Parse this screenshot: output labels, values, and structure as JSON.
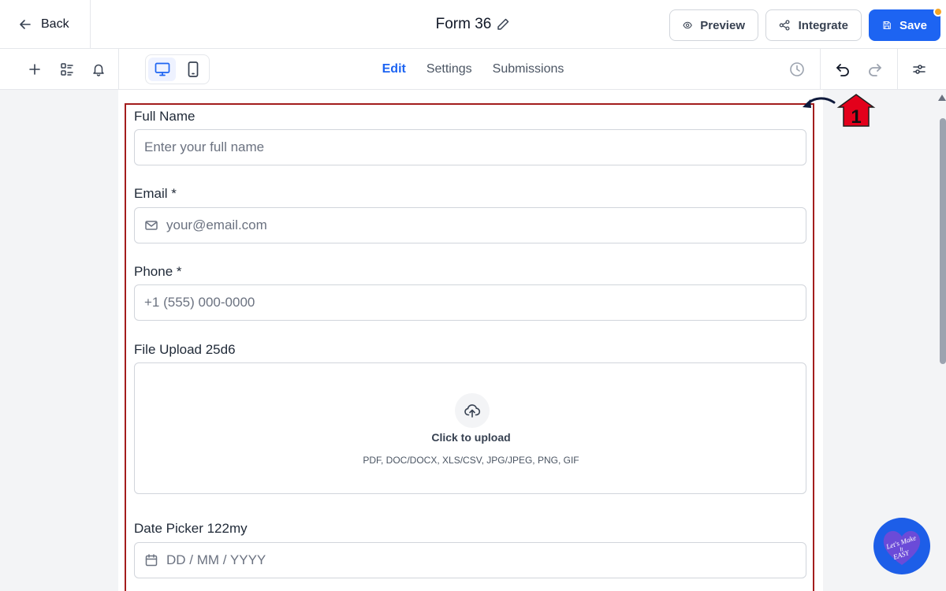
{
  "header": {
    "back_label": "Back",
    "form_title": "Form 36",
    "preview_label": "Preview",
    "integrate_label": "Integrate",
    "save_label": "Save"
  },
  "toolbar": {
    "tabs": [
      {
        "label": "Edit",
        "active": true
      },
      {
        "label": "Settings",
        "active": false
      },
      {
        "label": "Submissions",
        "active": false
      }
    ],
    "device_active": "desktop"
  },
  "form": {
    "fields": [
      {
        "label": "Full Name",
        "placeholder": "Enter your full name",
        "icon": ""
      },
      {
        "label": "Email *",
        "placeholder": "your@email.com",
        "icon": "mail-icon"
      },
      {
        "label": "Phone *",
        "placeholder": "+1 (555) 000-0000",
        "icon": ""
      },
      {
        "label": "File Upload 25d6",
        "upload_title": "Click to upload",
        "upload_types": "PDF, DOC/DOCX, XLS/CSV, JPG/JPEG, PNG, GIF",
        "icon": "upload-cloud-icon"
      },
      {
        "label": "Date Picker 122my",
        "placeholder": "DD / MM / YYYY",
        "icon": "calendar-icon"
      }
    ]
  },
  "annotation": {
    "step_number": "1"
  },
  "logo": {
    "text": "Let's Make It EASY"
  },
  "colors": {
    "accent": "#1d64f2",
    "frame": "#a31d1d",
    "badge_dot": "#f5a524",
    "annotation": "#e3001b"
  }
}
